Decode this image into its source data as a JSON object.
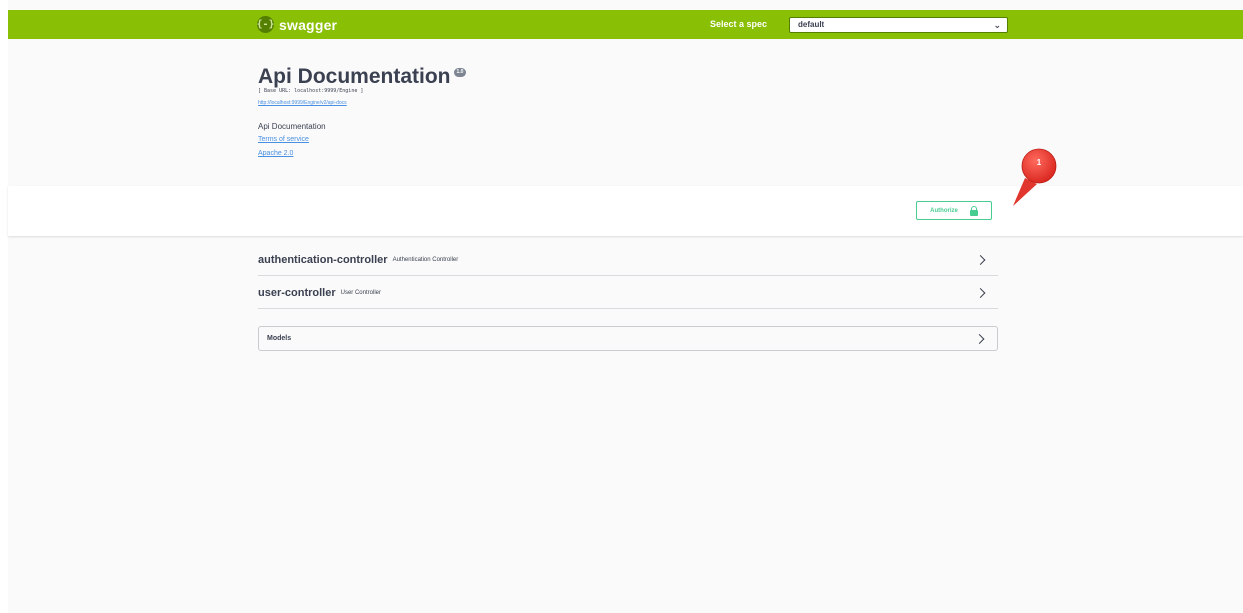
{
  "topbar": {
    "logo_icon": "{-}",
    "logo_text": "swagger",
    "spec_label": "Select a spec",
    "spec_value": "default",
    "spec_chevron": "⌄",
    "color": "#89bf04"
  },
  "info": {
    "title": "Api Documentation",
    "version": "1.0",
    "base_url": "[ Base URL: localhost:9999/Engine ]",
    "api_docs_url": "http://localhost:9999/Engine/v2/api-docs",
    "description": "Api Documentation",
    "terms_of_service": "Terms of service",
    "license": "Apache 2.0"
  },
  "authorize": {
    "label": "Authorize",
    "icon": "lock-icon",
    "color": "#49cc90"
  },
  "callout": {
    "label": "1",
    "color": "#e8413c"
  },
  "tags": [
    {
      "name": "authentication-controller",
      "description": "Authentication Controller"
    },
    {
      "name": "user-controller",
      "description": "User Controller"
    }
  ],
  "models": {
    "title": "Models"
  }
}
